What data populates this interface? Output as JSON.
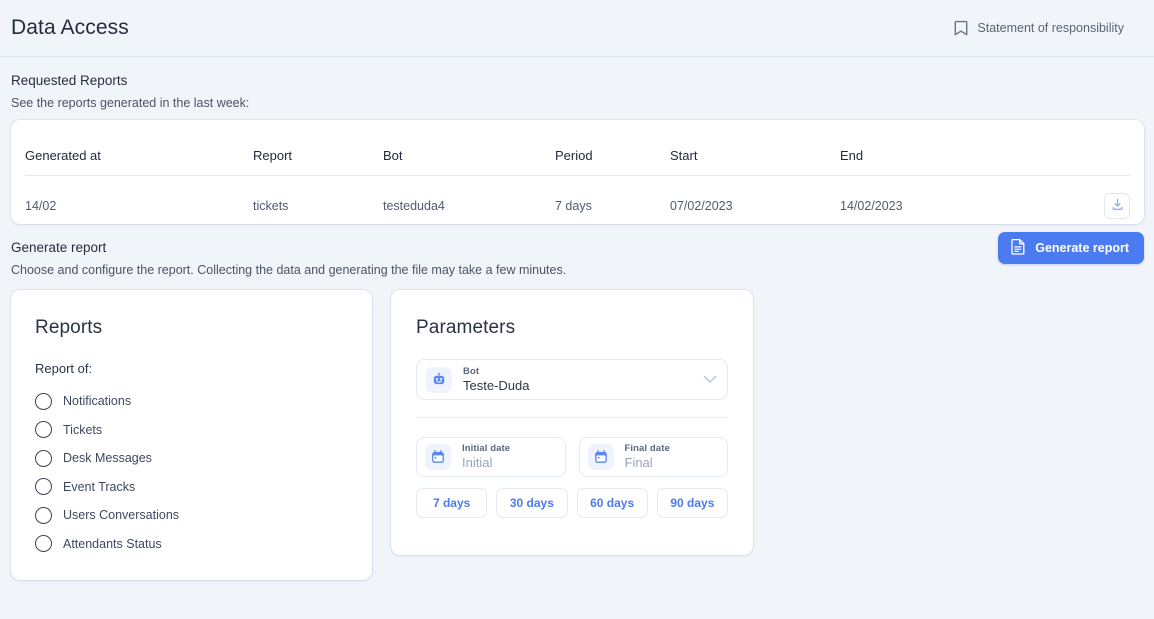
{
  "header": {
    "title": "Data Access",
    "statement_link": "Statement of responsibility",
    "statement_icon": "bookmark-icon"
  },
  "requested_reports": {
    "title": "Requested Reports",
    "subtitle": "See the reports generated in the last week:",
    "columns": [
      "Generated at",
      "Report",
      "Bot",
      "Period",
      "Start",
      "End"
    ],
    "rows": [
      {
        "generated_at": "14/02",
        "report": "tickets",
        "bot": "testeduda4",
        "period": "7 days",
        "start": "07/02/2023",
        "end": "14/02/2023",
        "action_icon": "download-icon"
      }
    ]
  },
  "generate": {
    "title": "Generate report",
    "subtitle": "Choose and configure the report. Collecting the data and generating the file may take a few minutes.",
    "button_label": "Generate report",
    "button_icon": "document-icon",
    "button_color": "#4a7bf0"
  },
  "reports_card": {
    "heading": "Reports",
    "report_of_label": "Report of:",
    "options": [
      "Notifications",
      "Tickets",
      "Desk Messages",
      "Event Tracks",
      "Users Conversations",
      "Attendants Status"
    ]
  },
  "parameters_card": {
    "heading": "Parameters",
    "bot": {
      "label": "Bot",
      "value": "Teste-Duda",
      "icon": "robot-icon",
      "chevron": "chevron-down-icon"
    },
    "initial_date": {
      "label": "Initial date",
      "placeholder": "Initial",
      "icon": "calendar-icon"
    },
    "final_date": {
      "label": "Final date",
      "placeholder": "Final",
      "icon": "calendar-icon"
    },
    "quick_ranges": [
      "7 days",
      "30 days",
      "60 days",
      "90 days"
    ]
  },
  "colors": {
    "page_background": "#f1f4f9",
    "accent_blue": "#4a7bf0",
    "card_background": "#ffffff",
    "text_primary": "#2c3345",
    "text_muted": "#5a6478"
  }
}
